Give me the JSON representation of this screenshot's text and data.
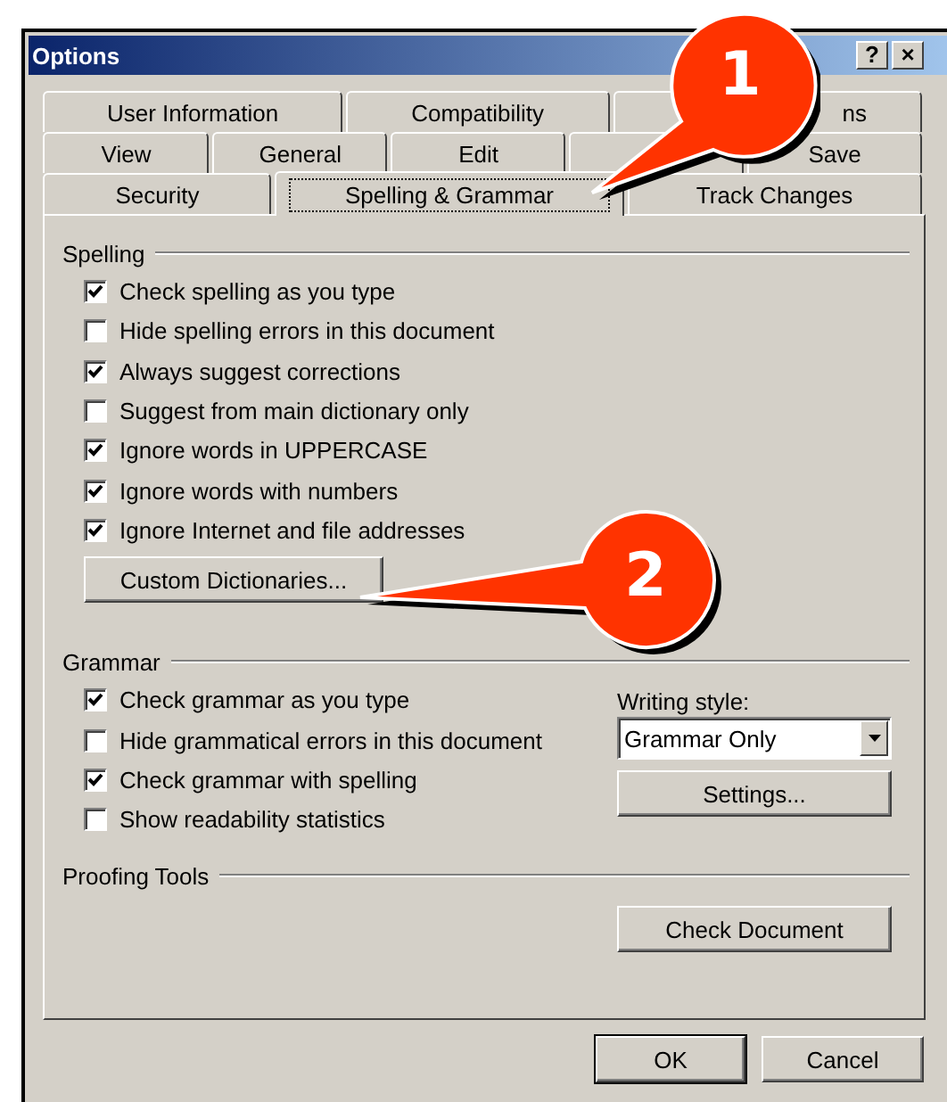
{
  "window": {
    "title": "Options",
    "title_buttons": [
      "?",
      "×"
    ]
  },
  "tab_rows": [
    [
      {
        "label": "User Information",
        "selected": false
      },
      {
        "label": "Compatibility",
        "selected": false
      },
      {
        "label": "ns",
        "selected": false
      }
    ],
    [
      {
        "label": "View",
        "selected": false
      },
      {
        "label": "General",
        "selected": false
      },
      {
        "label": "Edit",
        "selected": false
      },
      {
        "selected": false
      },
      {
        "label": "Save",
        "selected": false
      }
    ],
    [
      {
        "label": "Security",
        "selected": false
      },
      {
        "label": "Spelling & Grammar",
        "selected": true
      },
      {
        "label": "Track Changes",
        "selected": false
      }
    ]
  ],
  "spelling": {
    "title": "Spelling",
    "options": [
      {
        "label": "Check spelling as you type",
        "checked": true
      },
      {
        "label": "Hide spelling errors in this document",
        "checked": false
      },
      {
        "label": "Always suggest corrections",
        "checked": true
      },
      {
        "label": "Suggest from main dictionary only",
        "checked": false
      },
      {
        "label": "Ignore words in UPPERCASE",
        "checked": true
      },
      {
        "label": "Ignore words with numbers",
        "checked": true
      },
      {
        "label": "Ignore Internet and file addresses",
        "checked": true
      }
    ],
    "button": "Custom Dictionaries..."
  },
  "grammar": {
    "title": "Grammar",
    "options": [
      {
        "label": "Check grammar as you type",
        "checked": true
      },
      {
        "label": "Hide grammatical errors in this document",
        "checked": false
      },
      {
        "label": "Check grammar with spelling",
        "checked": true
      },
      {
        "label": "Show readability statistics",
        "checked": false
      }
    ],
    "writing_style_label": "Writing style:",
    "writing_style_value": "Grammar Only",
    "settings_button": "Settings..."
  },
  "proofing_tools": {
    "title": "Proofing Tools",
    "button": "Check Document"
  },
  "buttons": [
    "OK",
    "Cancel"
  ],
  "callouts": [
    {
      "number": "1"
    },
    {
      "number": "2"
    }
  ]
}
